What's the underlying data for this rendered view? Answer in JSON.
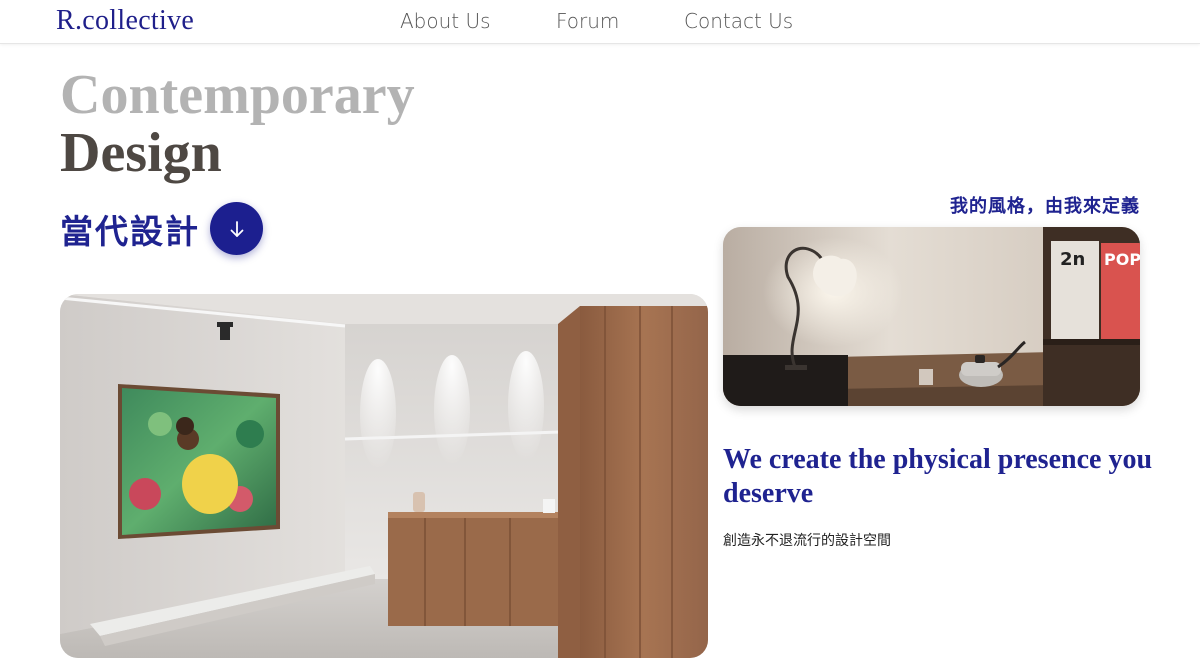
{
  "header": {
    "logo": "R.collective",
    "nav": [
      "About Us",
      "Forum",
      "Contact Us"
    ]
  },
  "hero": {
    "title_line1": "Contemporary",
    "title_line2": "Design",
    "title_zh": "當代設計",
    "scroll_button_icon": "arrow-down-icon"
  },
  "side": {
    "tagline": "我的風格，由我來定義",
    "statement": "We create the physical presence you deserve",
    "substatement": "創造永不退流行的設計空間"
  },
  "colors": {
    "brand_navy": "#1f2390",
    "title_grey": "#b3b3b3",
    "title_dark": "#4e4843"
  }
}
